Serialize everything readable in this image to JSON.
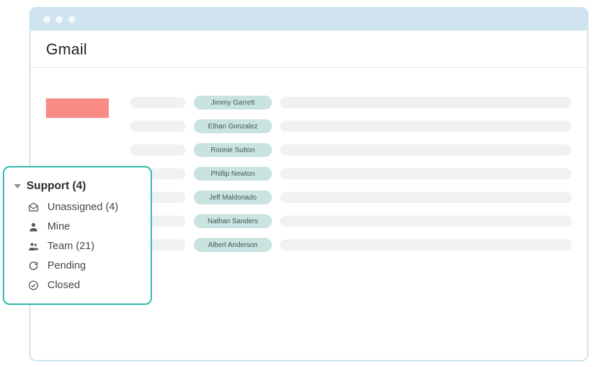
{
  "header": {
    "title": "Gmail"
  },
  "rows": [
    {
      "name": "Jimmy Garrett"
    },
    {
      "name": "Ethan Gonzalez"
    },
    {
      "name": "Ronnie Sutton"
    },
    {
      "name": "Phillip Newton"
    },
    {
      "name": "Jeff Maldonado"
    },
    {
      "name": "Nathan Sanders"
    },
    {
      "name": "Albert Anderson"
    }
  ],
  "popup": {
    "title": "Support (4)",
    "items": [
      {
        "label": "Unassigned (4)"
      },
      {
        "label": "Mine"
      },
      {
        "label": "Team (21)"
      },
      {
        "label": "Pending"
      },
      {
        "label": "Closed"
      }
    ]
  }
}
